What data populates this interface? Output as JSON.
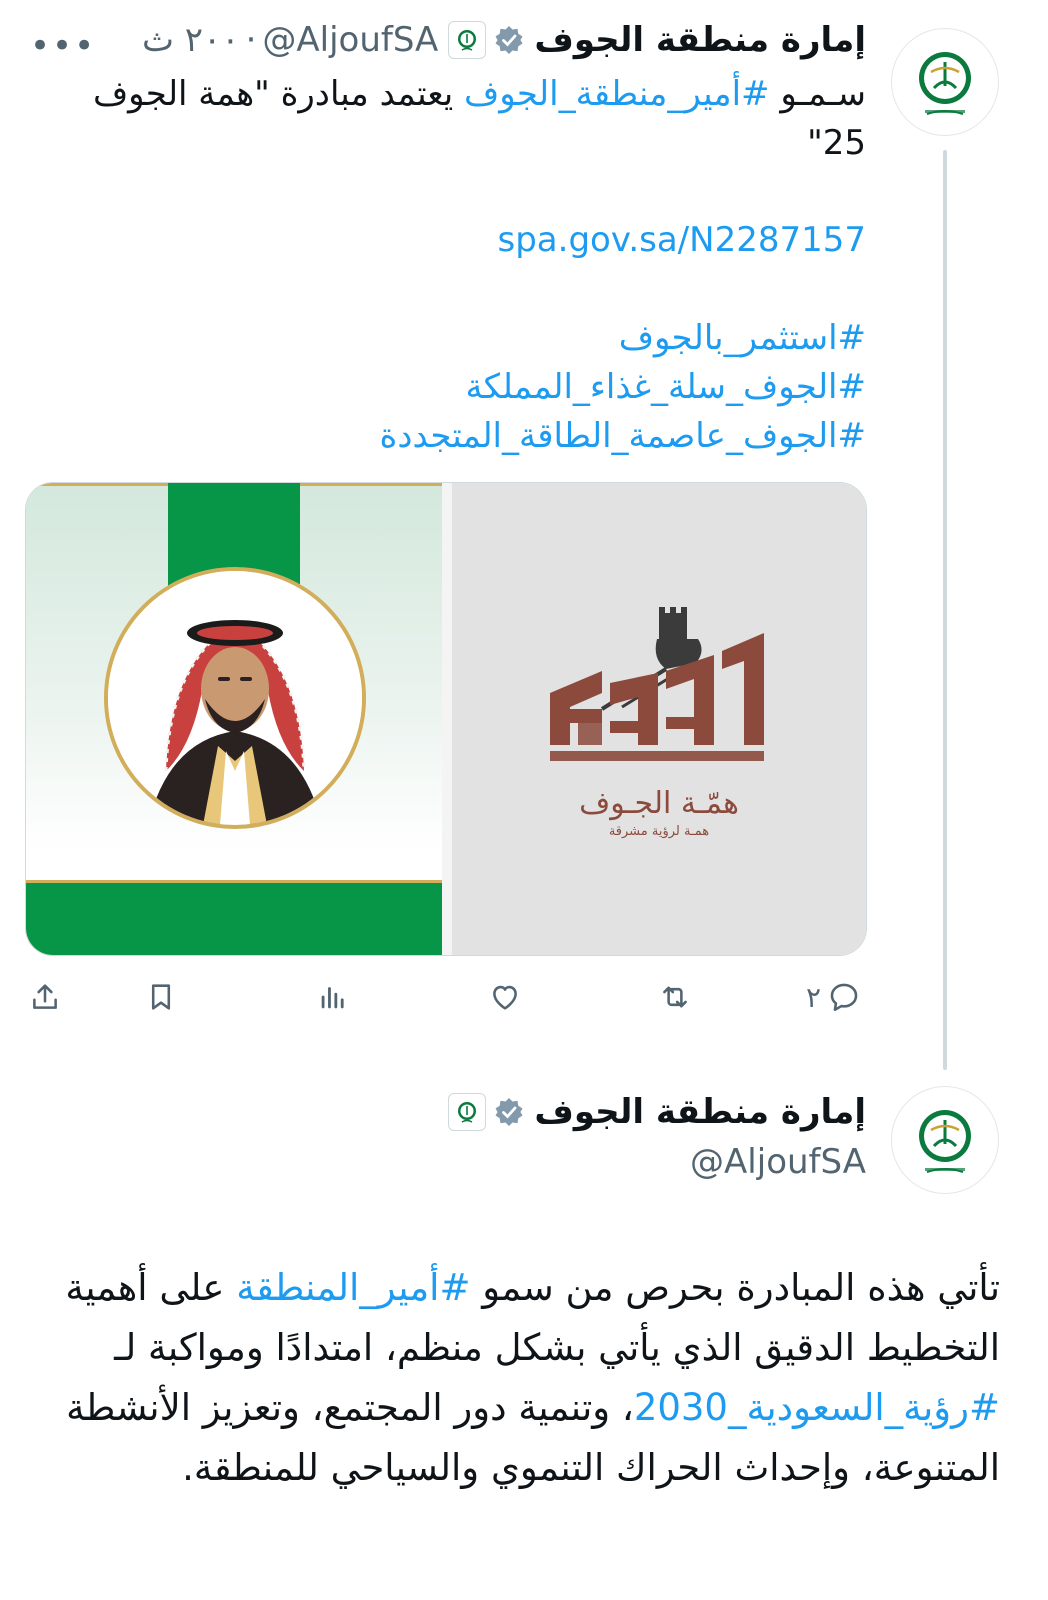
{
  "tweet1": {
    "author_name": "إمارة منطقة الجوف",
    "handle": "@AljoufSA",
    "separator": "·",
    "time": "٢٠٠ ث",
    "more": "•••",
    "text_prefix": "سـمـو ",
    "hashtag_prince": "#أمير_منطقة_الجوف",
    "text_suffix": " يعتمد مبادرة \"همة الجوف 25\"",
    "link": "spa.gov.sa/N2287157",
    "hashtags": [
      "#استثمر_بالجوف",
      "#الجوف_سلة_غذاء_المملكة",
      "#الجوف_عاصمة_الطاقة_المتجددة"
    ],
    "media_logo_title": "همّـة الجـوف",
    "media_logo_subtitle": "همـة لرؤية مشرقة",
    "actions": {
      "reply_count": "٢"
    }
  },
  "tweet2": {
    "author_name": "إمارة منطقة الجوف",
    "handle": "@AljoufSA",
    "body_1": "تأتي هذه المبادرة بحرص من سمو ",
    "hashtag_region": "#أمير_المنطقة",
    "body_2": " على أهمية التخطيط الدقيق الذي يأتي بشكل منظم، امتدادًا ومواكبة لـ ",
    "hashtag_vision": "#رؤية_السعودية_2030",
    "body_3": "، وتنمية دور المجتمع، وتعزيز الأنشطة المتنوعة، وإحداث الحراك التنموي والسياحي للمنطقة."
  },
  "colors": {
    "link": "#1d9bf0",
    "green": "#079548",
    "gold": "#d2ad5a",
    "logo_brown": "#8b4a3c"
  }
}
